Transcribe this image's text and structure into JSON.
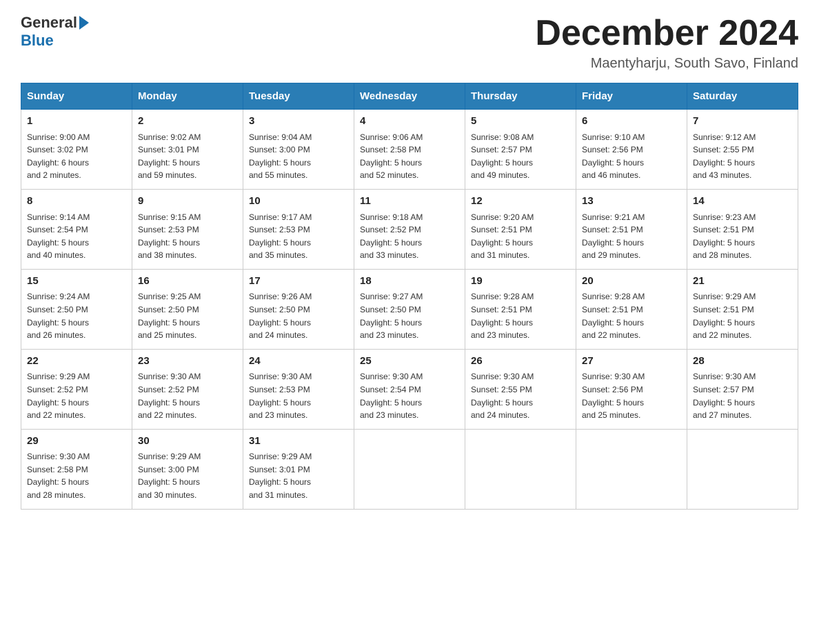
{
  "header": {
    "logo_general": "General",
    "logo_blue": "Blue",
    "month_title": "December 2024",
    "location": "Maentyharju, South Savo, Finland"
  },
  "weekdays": [
    "Sunday",
    "Monday",
    "Tuesday",
    "Wednesday",
    "Thursday",
    "Friday",
    "Saturday"
  ],
  "weeks": [
    [
      {
        "day": "1",
        "info": "Sunrise: 9:00 AM\nSunset: 3:02 PM\nDaylight: 6 hours\nand 2 minutes."
      },
      {
        "day": "2",
        "info": "Sunrise: 9:02 AM\nSunset: 3:01 PM\nDaylight: 5 hours\nand 59 minutes."
      },
      {
        "day": "3",
        "info": "Sunrise: 9:04 AM\nSunset: 3:00 PM\nDaylight: 5 hours\nand 55 minutes."
      },
      {
        "day": "4",
        "info": "Sunrise: 9:06 AM\nSunset: 2:58 PM\nDaylight: 5 hours\nand 52 minutes."
      },
      {
        "day": "5",
        "info": "Sunrise: 9:08 AM\nSunset: 2:57 PM\nDaylight: 5 hours\nand 49 minutes."
      },
      {
        "day": "6",
        "info": "Sunrise: 9:10 AM\nSunset: 2:56 PM\nDaylight: 5 hours\nand 46 minutes."
      },
      {
        "day": "7",
        "info": "Sunrise: 9:12 AM\nSunset: 2:55 PM\nDaylight: 5 hours\nand 43 minutes."
      }
    ],
    [
      {
        "day": "8",
        "info": "Sunrise: 9:14 AM\nSunset: 2:54 PM\nDaylight: 5 hours\nand 40 minutes."
      },
      {
        "day": "9",
        "info": "Sunrise: 9:15 AM\nSunset: 2:53 PM\nDaylight: 5 hours\nand 38 minutes."
      },
      {
        "day": "10",
        "info": "Sunrise: 9:17 AM\nSunset: 2:53 PM\nDaylight: 5 hours\nand 35 minutes."
      },
      {
        "day": "11",
        "info": "Sunrise: 9:18 AM\nSunset: 2:52 PM\nDaylight: 5 hours\nand 33 minutes."
      },
      {
        "day": "12",
        "info": "Sunrise: 9:20 AM\nSunset: 2:51 PM\nDaylight: 5 hours\nand 31 minutes."
      },
      {
        "day": "13",
        "info": "Sunrise: 9:21 AM\nSunset: 2:51 PM\nDaylight: 5 hours\nand 29 minutes."
      },
      {
        "day": "14",
        "info": "Sunrise: 9:23 AM\nSunset: 2:51 PM\nDaylight: 5 hours\nand 28 minutes."
      }
    ],
    [
      {
        "day": "15",
        "info": "Sunrise: 9:24 AM\nSunset: 2:50 PM\nDaylight: 5 hours\nand 26 minutes."
      },
      {
        "day": "16",
        "info": "Sunrise: 9:25 AM\nSunset: 2:50 PM\nDaylight: 5 hours\nand 25 minutes."
      },
      {
        "day": "17",
        "info": "Sunrise: 9:26 AM\nSunset: 2:50 PM\nDaylight: 5 hours\nand 24 minutes."
      },
      {
        "day": "18",
        "info": "Sunrise: 9:27 AM\nSunset: 2:50 PM\nDaylight: 5 hours\nand 23 minutes."
      },
      {
        "day": "19",
        "info": "Sunrise: 9:28 AM\nSunset: 2:51 PM\nDaylight: 5 hours\nand 23 minutes."
      },
      {
        "day": "20",
        "info": "Sunrise: 9:28 AM\nSunset: 2:51 PM\nDaylight: 5 hours\nand 22 minutes."
      },
      {
        "day": "21",
        "info": "Sunrise: 9:29 AM\nSunset: 2:51 PM\nDaylight: 5 hours\nand 22 minutes."
      }
    ],
    [
      {
        "day": "22",
        "info": "Sunrise: 9:29 AM\nSunset: 2:52 PM\nDaylight: 5 hours\nand 22 minutes."
      },
      {
        "day": "23",
        "info": "Sunrise: 9:30 AM\nSunset: 2:52 PM\nDaylight: 5 hours\nand 22 minutes."
      },
      {
        "day": "24",
        "info": "Sunrise: 9:30 AM\nSunset: 2:53 PM\nDaylight: 5 hours\nand 23 minutes."
      },
      {
        "day": "25",
        "info": "Sunrise: 9:30 AM\nSunset: 2:54 PM\nDaylight: 5 hours\nand 23 minutes."
      },
      {
        "day": "26",
        "info": "Sunrise: 9:30 AM\nSunset: 2:55 PM\nDaylight: 5 hours\nand 24 minutes."
      },
      {
        "day": "27",
        "info": "Sunrise: 9:30 AM\nSunset: 2:56 PM\nDaylight: 5 hours\nand 25 minutes."
      },
      {
        "day": "28",
        "info": "Sunrise: 9:30 AM\nSunset: 2:57 PM\nDaylight: 5 hours\nand 27 minutes."
      }
    ],
    [
      {
        "day": "29",
        "info": "Sunrise: 9:30 AM\nSunset: 2:58 PM\nDaylight: 5 hours\nand 28 minutes."
      },
      {
        "day": "30",
        "info": "Sunrise: 9:29 AM\nSunset: 3:00 PM\nDaylight: 5 hours\nand 30 minutes."
      },
      {
        "day": "31",
        "info": "Sunrise: 9:29 AM\nSunset: 3:01 PM\nDaylight: 5 hours\nand 31 minutes."
      },
      {
        "day": "",
        "info": ""
      },
      {
        "day": "",
        "info": ""
      },
      {
        "day": "",
        "info": ""
      },
      {
        "day": "",
        "info": ""
      }
    ]
  ]
}
